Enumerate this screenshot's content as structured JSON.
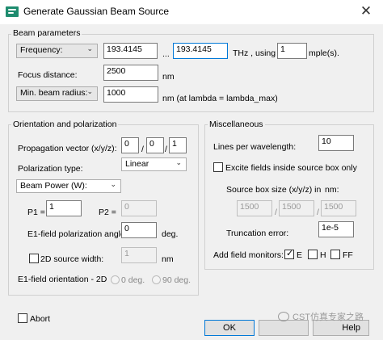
{
  "window": {
    "title": "Generate Gaussian Beam Source",
    "close_glyph": "✕"
  },
  "beam": {
    "group": "Beam parameters",
    "frequency_dropdown": "Frequency:",
    "freq_min": "193.4145",
    "ellipsis": "...",
    "freq_max": "193.4145",
    "unit_using": "THz , using",
    "samples": "1",
    "samples_suffix": "mple(s).",
    "focus_label": "Focus distance:",
    "focus_value": "2500",
    "focus_unit": "nm",
    "radius_dropdown": "Min. beam radius:",
    "radius_value": "1000",
    "radius_unit": "nm (at lambda = lambda_max)"
  },
  "orient": {
    "group": "Orientation and polarization",
    "prop_label": "Propagation vector (x/y/z):",
    "prop_x": "0",
    "prop_y": "0",
    "prop_z": "1",
    "slash": "/",
    "pol_type_label": "Polarization type:",
    "pol_type_value": "Linear",
    "power_dropdown": "Beam Power (W):",
    "p1_label": "P1 =",
    "p1_value": "1",
    "p2_label": "P2 =",
    "p2_value": "0",
    "e1_angle_label": "E1-field polarization angle:",
    "e1_angle_value": "0",
    "deg": "deg.",
    "source2d_label": "2D source width:",
    "source2d_value": "1",
    "nm": "nm",
    "e1_orient_label": "E1-field orientation - 2D",
    "radio_0": "0 deg.",
    "radio_90": "90 deg."
  },
  "misc": {
    "group": "Miscellaneous",
    "lpw_label": "Lines per wavelength:",
    "lpw_value": "10",
    "excite_label": "Excite fields inside source box only",
    "box_size_label": "Source box size (x/y/z) in",
    "box_size_unit": "nm:",
    "box_x": "1500",
    "box_y": "1500",
    "box_z": "1500",
    "trunc_label": "Truncation error:",
    "trunc_value": "1e-5",
    "monitors_label": "Add field monitors:",
    "mon_e": "E",
    "mon_h": "H",
    "mon_ff": "FF"
  },
  "footer": {
    "abort": "Abort",
    "ok": "OK",
    "help_visible": "Help",
    "watermark": "CST仿真专家之路"
  }
}
